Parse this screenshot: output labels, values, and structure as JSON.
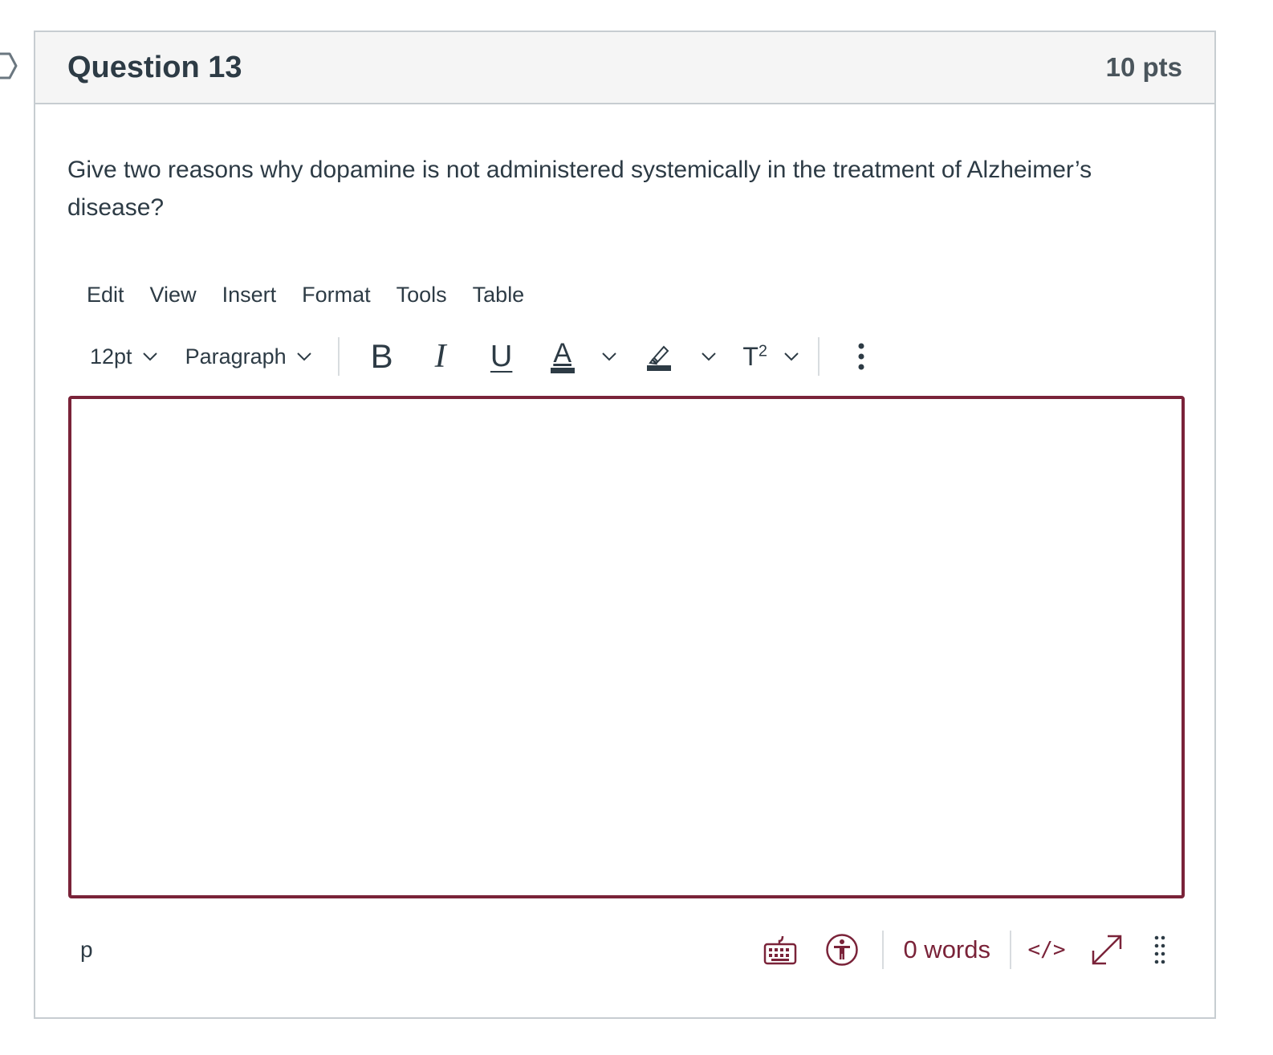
{
  "question": {
    "title": "Question 13",
    "points": "10 pts",
    "text": "Give two reasons why dopamine is not administered systemically in the treatment of Alzheimer’s disease?"
  },
  "editor": {
    "menubar": [
      "Edit",
      "View",
      "Insert",
      "Format",
      "Tools",
      "Table"
    ],
    "toolbar": {
      "font_size": "12pt",
      "block_format": "Paragraph",
      "bold_label": "B",
      "italic_label": "I",
      "underline_label": "U",
      "font_color_label": "A",
      "superscript_label": "T",
      "superscript_sup": "2",
      "icons": [
        "bold-icon",
        "italic-icon",
        "underline-icon",
        "text-color-icon",
        "highlight-icon",
        "superscript-icon",
        "more-options-icon"
      ]
    },
    "content": "",
    "status": {
      "path": "p",
      "word_count": "0 words",
      "code_view_label": "</>",
      "icons": [
        "keyboard-icon",
        "accessibility-icon",
        "fullscreen-icon",
        "resize-handle-icon"
      ]
    }
  },
  "colors": {
    "accent": "#7a2339",
    "text": "#2d3b45",
    "header_bg": "#f5f5f5",
    "border": "#c7cdd1"
  }
}
